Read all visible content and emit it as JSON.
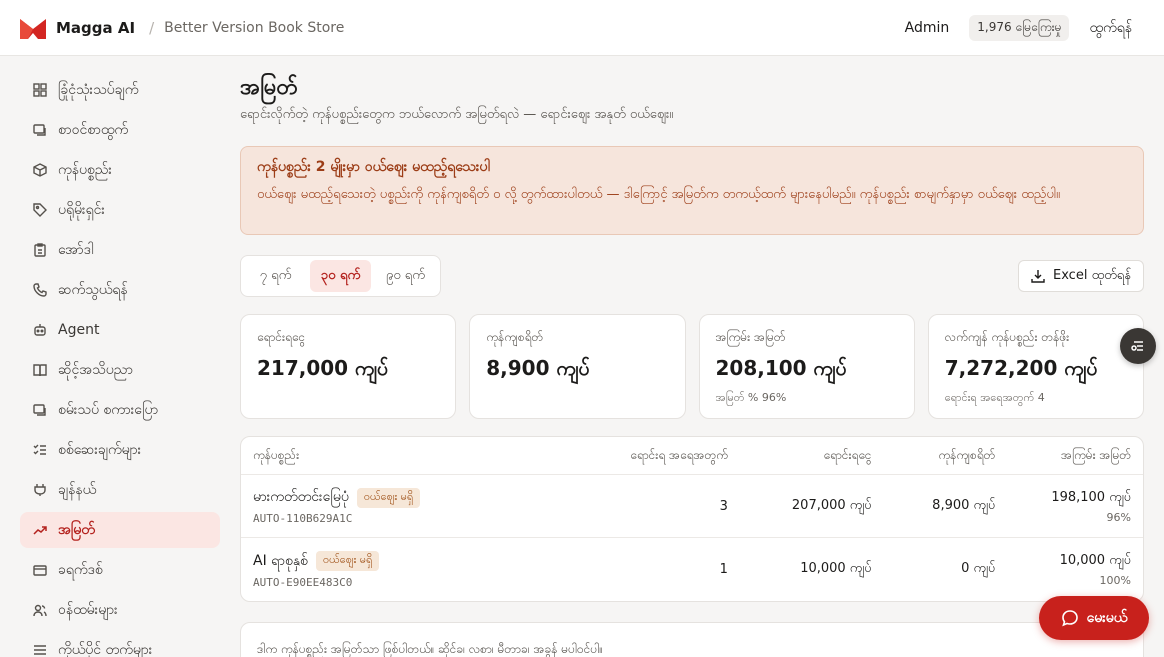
{
  "header": {
    "brand": "Magga AI",
    "store": "Better Version Book Store",
    "user": "Admin",
    "visits": "1,976 မြေကြေးမှု",
    "logout": "ထွက်ရန်"
  },
  "sidebar": {
    "items": [
      {
        "label": "ခြုံငုံသုံးသပ်ချက်",
        "icon": "grid-icon"
      },
      {
        "label": "စာဝင်စာထွက်",
        "icon": "inbox-icon"
      },
      {
        "label": "ကုန်ပစ္စည်း",
        "icon": "box-icon"
      },
      {
        "label": "ပရိုမိုးရှင်း",
        "icon": "tag-icon"
      },
      {
        "label": "အော်ဒါ",
        "icon": "clipboard-icon"
      },
      {
        "label": "ဆက်သွယ်ရန်",
        "icon": "phone-icon"
      },
      {
        "label": "Agent",
        "icon": "robot-icon"
      },
      {
        "label": "ဆိုင့်အသိပညာ",
        "icon": "book-icon"
      },
      {
        "label": "စမ်းသပ် စကားပြော",
        "icon": "chat-icon"
      },
      {
        "label": "စစ်ဆေးချက်များ",
        "icon": "checklist-icon"
      },
      {
        "label": "ချန်နယ်",
        "icon": "plug-icon"
      },
      {
        "label": "အမြတ်",
        "icon": "trend-icon",
        "active": true
      },
      {
        "label": "ခရက်ဒစ်",
        "icon": "card-icon"
      },
      {
        "label": "ဝန်ထမ်းများ",
        "icon": "users-icon"
      },
      {
        "label": "ကိုယ်ပိုင် တက်များ",
        "icon": "settings-list-icon"
      }
    ]
  },
  "page": {
    "title": "အမြတ်",
    "subtitle": "ရောင်းလိုက်တဲ့ ကုန်ပစ္စည်းတွေက ဘယ်လောက် အမြတ်ရလဲ — ရောင်းဈေး အနုတ် ဝယ်ဈေး။"
  },
  "warning": {
    "title": "ကုန်ပစ္စည်း 2 မျိုးမှာ ဝယ်ဈေး မထည့်ရသေးပါ",
    "body": "ဝယ်ဈေး မထည့်ရသေးတဲ့ ပစ္စည်းကို ကုန်ကျစရိတ် ၀ လို့ တွက်ထားပါတယ် — ဒါကြောင့် အမြတ်က တကယ့်ထက် များနေပါမည်။ ကုန်ပစ္စည်း စာမျက်နှာမှာ ဝယ်ဈေး ထည့်ပါ။"
  },
  "ranges": [
    {
      "label": "၇ ရက်",
      "active": false
    },
    {
      "label": "၃၀ ရက်",
      "active": true
    },
    {
      "label": "၉၀ ရက်",
      "active": false
    }
  ],
  "excel_button": "Excel ထုတ်ရန်",
  "stats": [
    {
      "label": "ရောင်းရငွေ",
      "value": "217,000 ကျပ်",
      "note": ""
    },
    {
      "label": "ကုန်ကျစရိတ်",
      "value": "8,900 ကျပ်",
      "note": ""
    },
    {
      "label": "အကြမ်း အမြတ်",
      "value": "208,100 ကျပ်",
      "note": "အမြတ် % 96%"
    },
    {
      "label": "လက်ကျန် ကုန်ပစ္စည်း တန်ဖိုး",
      "value": "7,272,200 ကျပ်",
      "note": "ရောင်းရ အရေအတွက် 4"
    }
  ],
  "table": {
    "headers": [
      "ကုန်ပစ္စည်း",
      "ရောင်းရ အရေအတွက်",
      "ရောင်းရငွေ",
      "ကုန်ကျစရိတ်",
      "အကြမ်း အမြတ်"
    ],
    "rows": [
      {
        "name": "မားကတ်တင်းမြေပုံ",
        "badge": "ဝယ်ဈေး မရှိ",
        "sku": "AUTO-110B629A1C",
        "qty": "3",
        "revenue": "207,000 ကျပ်",
        "cost": "8,900 ကျပ်",
        "profit": "198,100 ကျပ်",
        "pct": "96%"
      },
      {
        "name": "AI ရာစုနှစ်",
        "badge": "ဝယ်ဈေး မရှိ",
        "sku": "AUTO-E90EE483C0",
        "qty": "1",
        "revenue": "10,000 ကျပ်",
        "cost": "0 ကျပ်",
        "profit": "10,000 ကျပ်",
        "pct": "100%"
      }
    ]
  },
  "footnote": "ဒါက ကုန်ပစ္စည်း အမြတ်သာ ဖြစ်ပါတယ်။ ဆိုင်ခ၊ လစာ၊ မီတာခ၊ အခွန် မပါဝင်ပါ။",
  "chat_button": "မေးမယ်",
  "colors": {
    "accent": "#c8211c",
    "warning_bg": "#f6e5dc",
    "active_bg": "#fbe6e3"
  }
}
